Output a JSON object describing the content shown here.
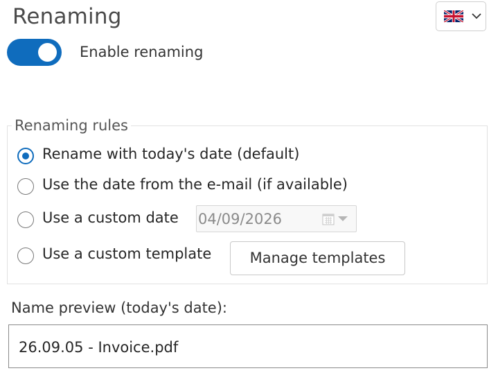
{
  "header": {
    "title": "Renaming",
    "language": {
      "selected": "en-GB",
      "flag_icon": "uk-flag-icon",
      "dropdown_icon": "chevron-down-icon"
    }
  },
  "toggle": {
    "label": "Enable renaming",
    "enabled": true,
    "accent_color": "#0f6cbd"
  },
  "rules": {
    "legend": "Renaming rules",
    "options": [
      {
        "label": "Rename with today's date (default)",
        "checked": true
      },
      {
        "label": "Use the date from the e-mail (if available)",
        "checked": false
      },
      {
        "label": "Use a custom date",
        "checked": false
      },
      {
        "label": "Use a custom template",
        "checked": false
      }
    ],
    "custom_date": {
      "value": "04/09/2026",
      "icon": "calendar-icon",
      "disabled": true
    },
    "manage_templates_label": "Manage templates"
  },
  "preview": {
    "label": "Name preview (today's date):",
    "value": "26.09.05 - Invoice.pdf"
  }
}
